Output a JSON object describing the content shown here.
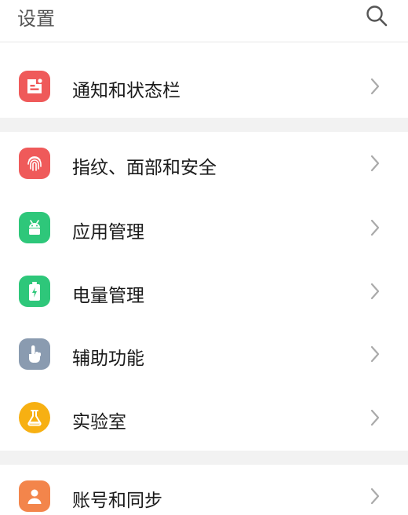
{
  "header": {
    "title": "设置",
    "search_icon": "search-icon"
  },
  "colors": {
    "notification": "#ef5a5a",
    "fingerprint": "#ef5a5a",
    "apps": "#2ec77a",
    "battery": "#2ec77a",
    "accessibility": "#8a9bb0",
    "lab": "#f7b012",
    "account": "#f3854b",
    "divider": "#f2f2f2"
  },
  "items": [
    {
      "label": "通知和状态栏",
      "icon": "notification-bar-icon"
    },
    {
      "label": "指纹、面部和安全",
      "icon": "fingerprint-icon"
    },
    {
      "label": "应用管理",
      "icon": "android-icon"
    },
    {
      "label": "电量管理",
      "icon": "battery-icon"
    },
    {
      "label": "辅助功能",
      "icon": "hand-pointer-icon"
    },
    {
      "label": "实验室",
      "icon": "flask-icon"
    },
    {
      "label": "账号和同步",
      "icon": "person-icon"
    }
  ]
}
